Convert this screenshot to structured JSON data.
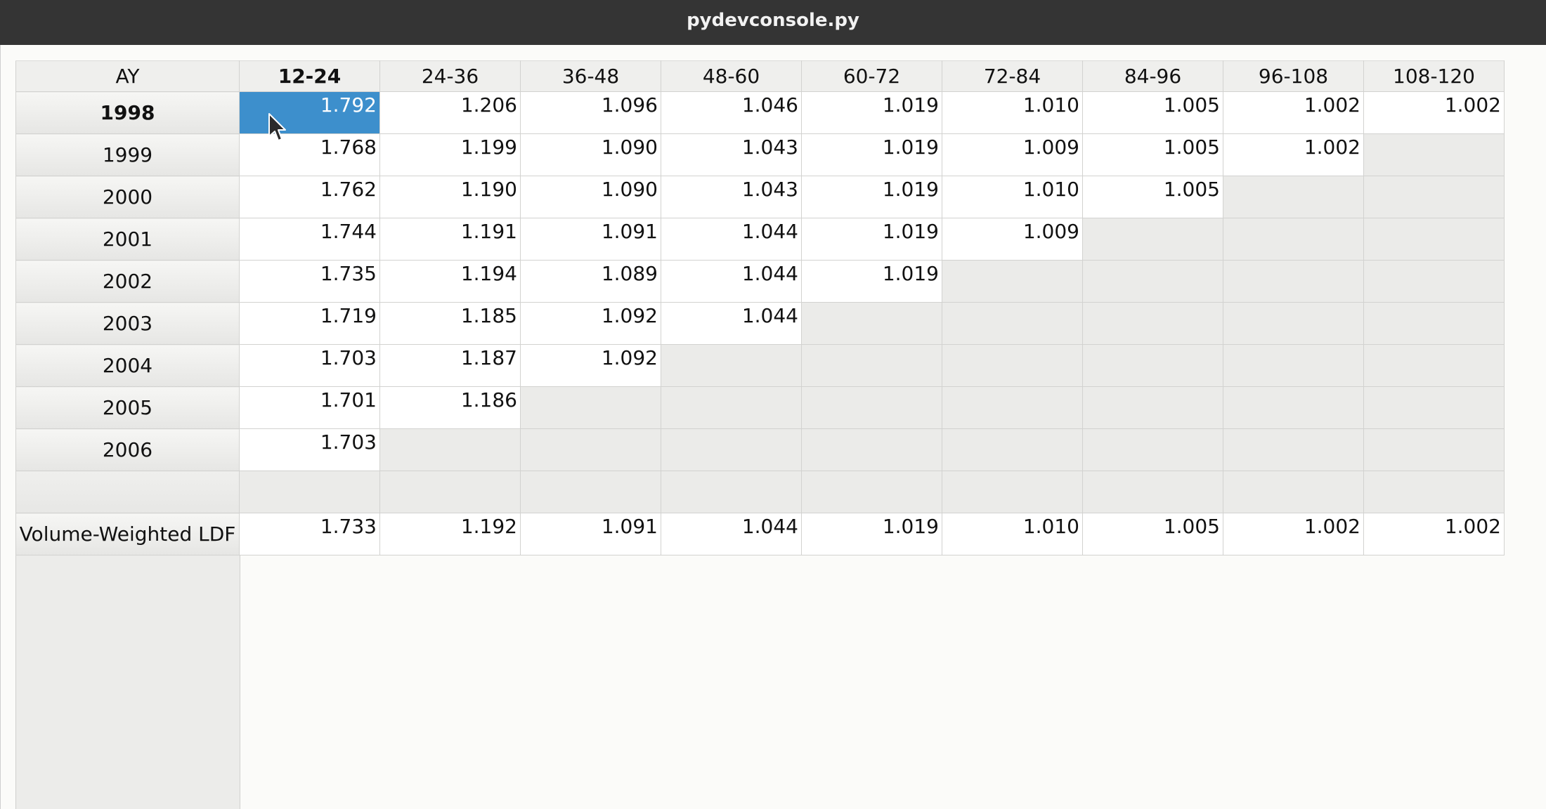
{
  "window": {
    "title": "pydevconsole.py"
  },
  "table": {
    "corner_label": "AY",
    "columns": [
      "12-24",
      "24-36",
      "36-48",
      "48-60",
      "60-72",
      "72-84",
      "84-96",
      "96-108",
      "108-120"
    ],
    "rows": [
      {
        "label": "1998",
        "cells": [
          "1.792",
          "1.206",
          "1.096",
          "1.046",
          "1.019",
          "1.010",
          "1.005",
          "1.002",
          "1.002"
        ]
      },
      {
        "label": "1999",
        "cells": [
          "1.768",
          "1.199",
          "1.090",
          "1.043",
          "1.019",
          "1.009",
          "1.005",
          "1.002",
          ""
        ]
      },
      {
        "label": "2000",
        "cells": [
          "1.762",
          "1.190",
          "1.090",
          "1.043",
          "1.019",
          "1.010",
          "1.005",
          "",
          ""
        ]
      },
      {
        "label": "2001",
        "cells": [
          "1.744",
          "1.191",
          "1.091",
          "1.044",
          "1.019",
          "1.009",
          "",
          "",
          ""
        ]
      },
      {
        "label": "2002",
        "cells": [
          "1.735",
          "1.194",
          "1.089",
          "1.044",
          "1.019",
          "",
          "",
          "",
          ""
        ]
      },
      {
        "label": "2003",
        "cells": [
          "1.719",
          "1.185",
          "1.092",
          "1.044",
          "",
          "",
          "",
          "",
          ""
        ]
      },
      {
        "label": "2004",
        "cells": [
          "1.703",
          "1.187",
          "1.092",
          "",
          "",
          "",
          "",
          "",
          ""
        ]
      },
      {
        "label": "2005",
        "cells": [
          "1.701",
          "1.186",
          "",
          "",
          "",
          "",
          "",
          "",
          ""
        ]
      },
      {
        "label": "2006",
        "cells": [
          "1.703",
          "",
          "",
          "",
          "",
          "",
          "",
          "",
          ""
        ]
      },
      {
        "label": "",
        "cells": [
          "",
          "",
          "",
          "",
          "",
          "",
          "",
          "",
          ""
        ]
      },
      {
        "label": "Volume-Weighted LDF",
        "cells": [
          "1.733",
          "1.192",
          "1.091",
          "1.044",
          "1.019",
          "1.010",
          "1.005",
          "1.002",
          "1.002"
        ]
      }
    ],
    "selected": {
      "row": 0,
      "col": 0
    },
    "colors": {
      "selection": "#3d8fcc",
      "empty_cell": "#ebebe9",
      "titlebar": "#343434"
    }
  },
  "icons": {
    "cursor": "mouse-pointer-icon"
  }
}
